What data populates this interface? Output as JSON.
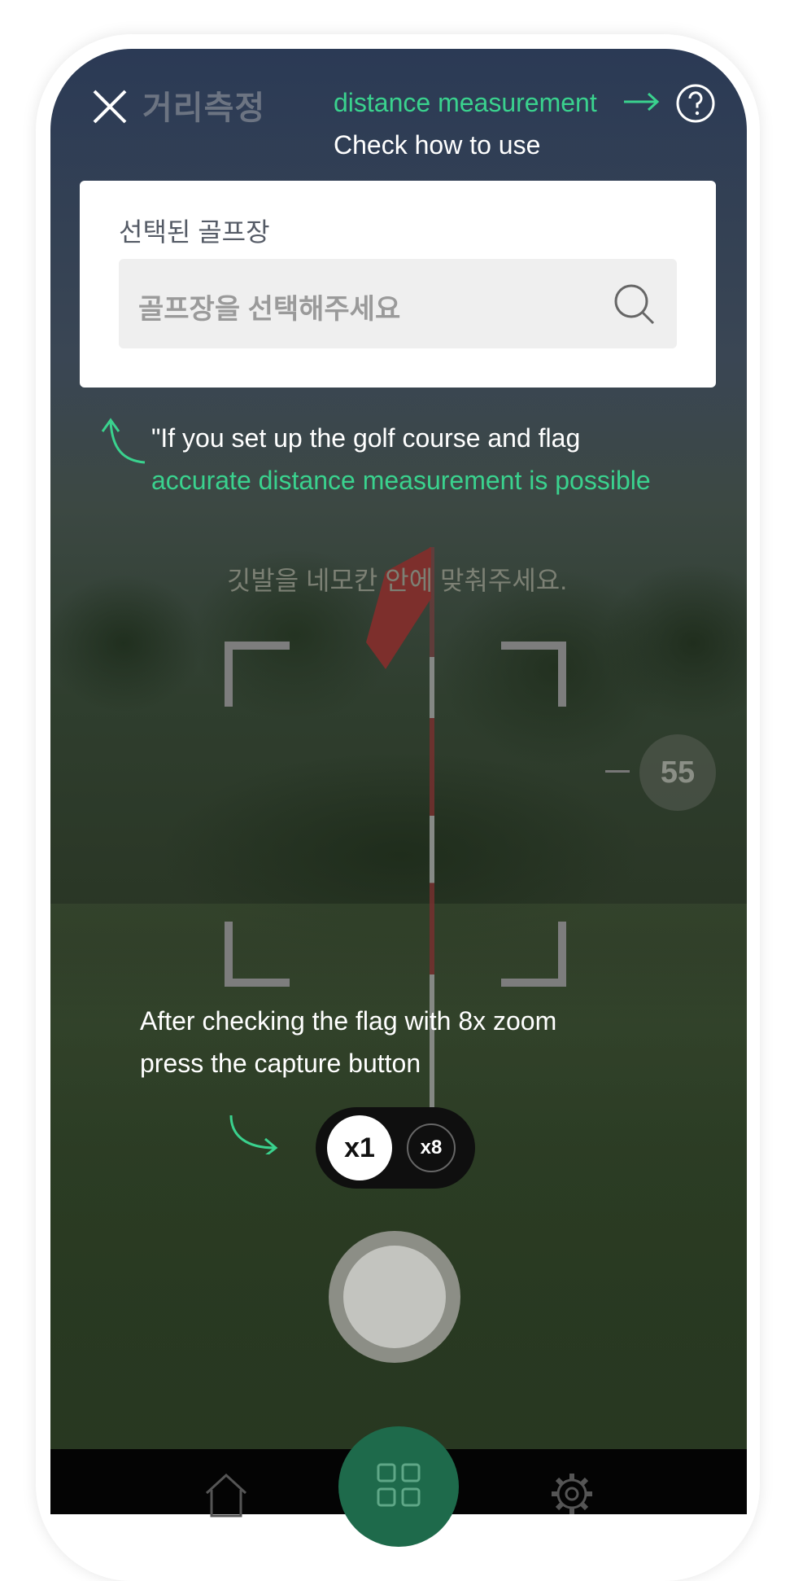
{
  "header": {
    "title": "거리측정",
    "help_line1": "distance measurement",
    "help_line2": "Check how to use"
  },
  "course_card": {
    "label": "선택된 골프장",
    "search_placeholder": "골프장을 선택해주세요"
  },
  "tips": {
    "setup_line1": "\"If you set up the golf course and flag",
    "setup_line2": "accurate distance measurement is possible",
    "frame_hint": "깃발을 네모칸 안에 맞춰주세요.",
    "capture_line1": "After checking the flag with 8x zoom",
    "capture_line2": "press the capture button"
  },
  "level_indicator": "55",
  "zoom": {
    "x1_label": "x1",
    "x8_label": "x8",
    "selected": "x1"
  },
  "icons": {
    "close": "close-icon",
    "help": "help-icon",
    "search": "search-icon",
    "home": "home-icon",
    "grid": "grid-icon",
    "settings": "gear-icon"
  },
  "colors": {
    "accent_green": "#3ad28e",
    "nav_center": "#1e6a4b",
    "card_bg": "#ffffff",
    "search_bg": "#efefef"
  }
}
